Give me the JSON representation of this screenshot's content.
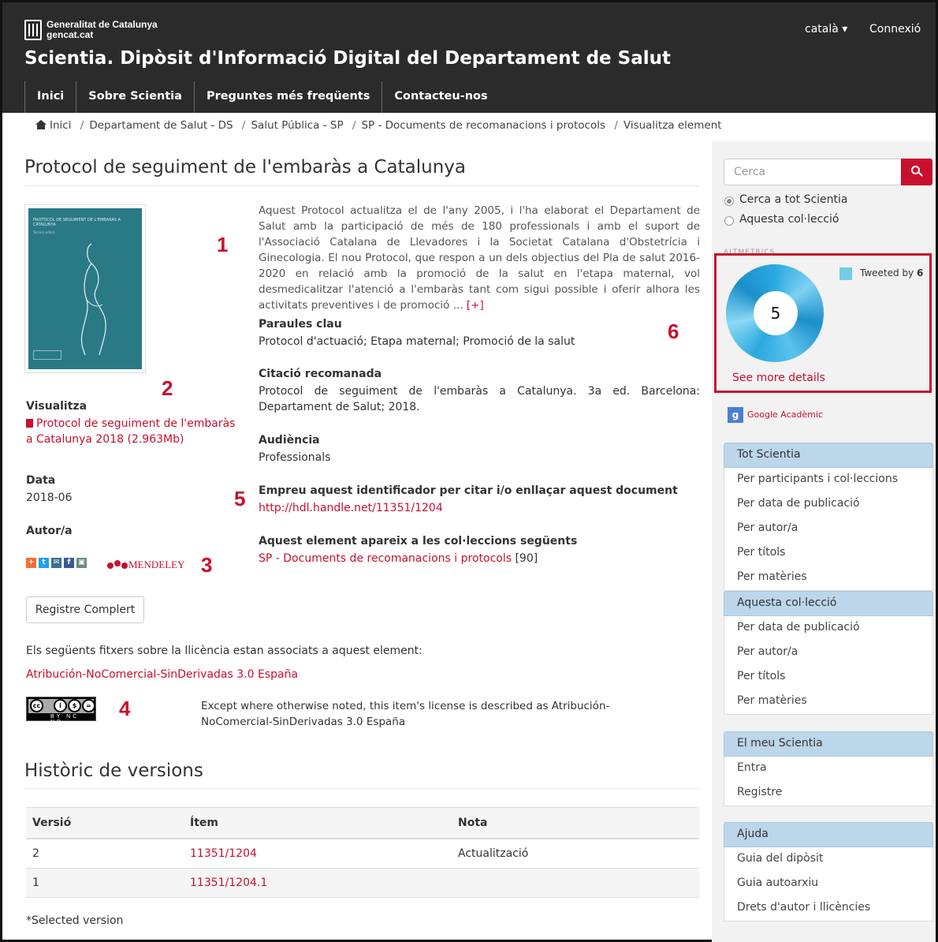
{
  "header": {
    "org_line1": "Generalitat de Catalunya",
    "org_line2": "gencat.cat",
    "site_title": "Scientia. Dipòsit d'Informació Digital del Departament de Salut",
    "language": "català ▾",
    "login": "Connexió",
    "nav": [
      "Inici",
      "Sobre Scientia",
      "Preguntes més freqüents",
      "Contacteu-nos"
    ]
  },
  "breadcrumb": [
    "Inici",
    "Departament de Salut - DS",
    "Salut Pública - SP",
    "SP - Documents de recomanacions i protocols",
    "Visualitza element"
  ],
  "item": {
    "title": "Protocol de seguiment de l'embaràs a Catalunya",
    "thumb_title": "PROTOCOL DE SEGUIMENT DE L'EMBARÀS A CATALUNYA",
    "thumb_subtitle": "Tercera edició",
    "abstract": "Aquest Protocol actualitza el de l'any 2005, i l'ha elaborat el Departament de Salut amb la participació de més de 180 professionals i amb el suport de l'Associació Catalana de Llevadores i la Societat Catalana d'Obstetrícia i Ginecologia. El nou Protocol, que respon a un dels objectius del Pla de salut 2016-2020 en relació amb la promoció de la salut en l'etapa maternal, vol desmedicalitzar l'atenció a l'embaràs tant com sigui possible i oferir alhora les activitats preventives i de promoció ...",
    "more": "[+]",
    "view_label": "Visualitza",
    "file_line1": "Protocol de seguiment de l'embaràs",
    "file_line2": "a Catalunya 2018 (2.963Mb)",
    "date_label": "Data",
    "date_value": "2018-06",
    "author_label": "Autor/a",
    "mendeley": "MENDELEY",
    "full_record_button": "Registre Complert",
    "keywords_label": "Paraules clau",
    "keywords_value": "Protocol d'actuació; Etapa maternal; Promoció de la salut",
    "citation_label": "Citació recomanada",
    "citation_value": "Protocol de seguiment de l'embaràs a Catalunya. 3a ed. Barcelona: Departament de Salut; 2018.",
    "audience_label": "Audiència",
    "audience_value": "Professionals",
    "handle_label": "Empreu aquest identificador per citar i/o enllaçar aquest document",
    "handle_url": "http://hdl.handle.net/11351/1204",
    "collections_label": "Aquest element apareix a les col·leccions següents",
    "collection_link": "SP - Documents de recomanacions i protocols",
    "collection_count": "[90]",
    "license_intro": "Els següents fitxers sobre la llicència estan associats a aquest element:",
    "license_link": "Atribución-NoComercial-SinDerivadas 3.0 España",
    "license_note_line1": "Except where otherwise noted, this item's license is described as Atribución-",
    "license_note_line2": "NoComercial-SinDerivadas 3.0 España",
    "cc_badge_text": "BY NC ND"
  },
  "markers": [
    "1",
    "2",
    "3",
    "4",
    "5",
    "6"
  ],
  "versions": {
    "title": "Històric de versions",
    "columns": [
      "Versió",
      "Ítem",
      "Nota"
    ],
    "rows": [
      {
        "version": "2",
        "item": "11351/1204",
        "note": "Actualització"
      },
      {
        "version": "1",
        "item": "11351/1204.1",
        "note": ""
      }
    ],
    "footnote": "*Selected version"
  },
  "sidebar": {
    "search_placeholder": "Cerca",
    "scope_all": "Cerca a tot Scientia",
    "scope_collection": "Aquesta col·lecció",
    "altmetric_label": "ALTMETRICS",
    "altmetric_score": "5",
    "tweeted_by": "Tweeted by",
    "tweeted_count": "6",
    "see_more": "See more details",
    "google_scholar": "Google Acadèmic",
    "panels": [
      {
        "title": "Tot Scientia",
        "items": [
          "Per participants i col·leccions",
          "Per data de publicació",
          "Per autor/a",
          "Per títols",
          "Per matèries"
        ]
      },
      {
        "title": "Aquesta col·lecció",
        "items": [
          "Per data de publicació",
          "Per autor/a",
          "Per títols",
          "Per matèries"
        ]
      },
      {
        "title": "El meu Scientia",
        "items": [
          "Entra",
          "Registre"
        ]
      },
      {
        "title": "Ajuda",
        "items": [
          "Guia del dipòsit",
          "Guia autoarxiu",
          "Drets d'autor i llicències"
        ]
      }
    ]
  },
  "colors": {
    "accent": "#c8102e",
    "header_bg": "#2b2b2b",
    "panel_head": "#bcd6ea",
    "sidebar_bg": "#f2f2f2",
    "altmetric_blue": "#2aa9e0"
  }
}
